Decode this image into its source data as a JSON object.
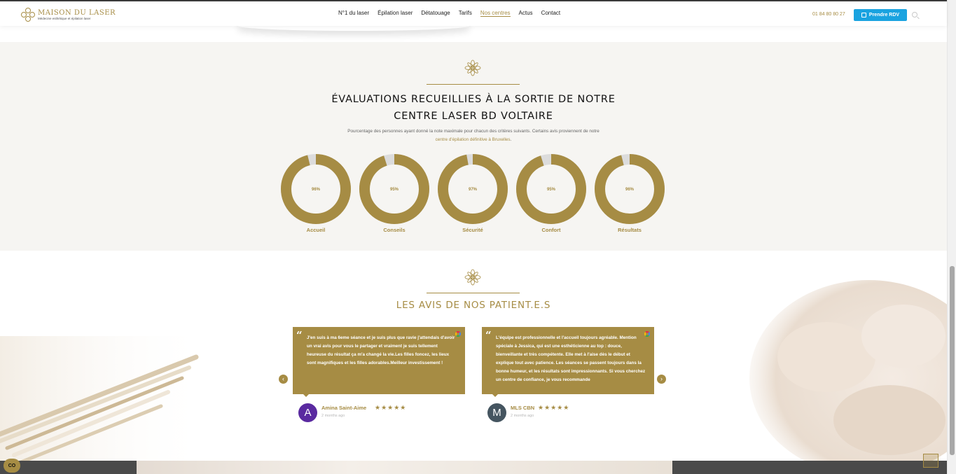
{
  "header": {
    "logo_title": "MAISON DU LASER",
    "logo_subtitle": "Médecine esthétique et épilation laser",
    "nav": [
      "N°1 du laser",
      "Épilation laser",
      "Détatouage",
      "Tarifs",
      "Nos centres",
      "Actus",
      "Contact"
    ],
    "active_nav": "Nos centres",
    "phone": "01 84 80 80 27",
    "rdv_label": "Prendre RDV"
  },
  "ratings": {
    "title_line1": "ÉVALUATIONS RECUEILLIES À LA SORTIE DE NOTRE",
    "title_line2": "CENTRE LASER BD VOLTAIRE",
    "description": "Pourcentage des personnes ayant donné la note maximale pour chacun des critères suivants. Certains avis proviennent de notre",
    "description_link": "centre d'épilation définitive à Bruxelles",
    "description_end": ".",
    "items": [
      {
        "label": "Accueil",
        "value": 96,
        "display": "96%"
      },
      {
        "label": "Conseils",
        "value": 95,
        "display": "95%"
      },
      {
        "label": "Sécurité",
        "value": 97,
        "display": "97%"
      },
      {
        "label": "Confort",
        "value": 95,
        "display": "95%"
      },
      {
        "label": "Résultats",
        "value": 96,
        "display": "96%"
      }
    ],
    "colors": {
      "fill": "#a68c44",
      "track": "#dcdcdc"
    }
  },
  "reviews": {
    "title": "LES AVIS DE NOS PATIENT.E.S",
    "items": [
      {
        "text": "J'en suis à ma 6eme séance et je suis plus que ravie j'attendais d'avoir un vrai avis pour vous le partager et vraiment je suis tellement heureuse du résultat ça m'a changé la vie.Les filles foncez, les lieux sont magnifiques et les filles adorables.Meilleur investissement !",
        "author": "Amina Saint-Aime",
        "initial": "A",
        "avatar_color": "#5a2aa0",
        "stars": "★★★★★",
        "ago": "2 months ago"
      },
      {
        "text": "L'équipe est professionnelle et l'accueil toujours agréable. Mention spéciale à Jessica, qui est une esthéticienne au top : douce, bienveillante et très compétente. Elle met à l'aise dès le début et explique tout avec patience. Les séances se passent toujours dans la bonne humeur, et les résultats sont impressionnants. Si vous cherchez un centre de confiance, je vous recommande",
        "author": "MLS CBN",
        "initial": "M",
        "avatar_color": "#455560",
        "stars": "★★★★★",
        "ago": "2 months ago"
      }
    ],
    "prev_icon": "‹",
    "next_icon": "›"
  },
  "cookie_label": "CO",
  "accent": "#a68c44",
  "button_color": "#1aa3e0"
}
